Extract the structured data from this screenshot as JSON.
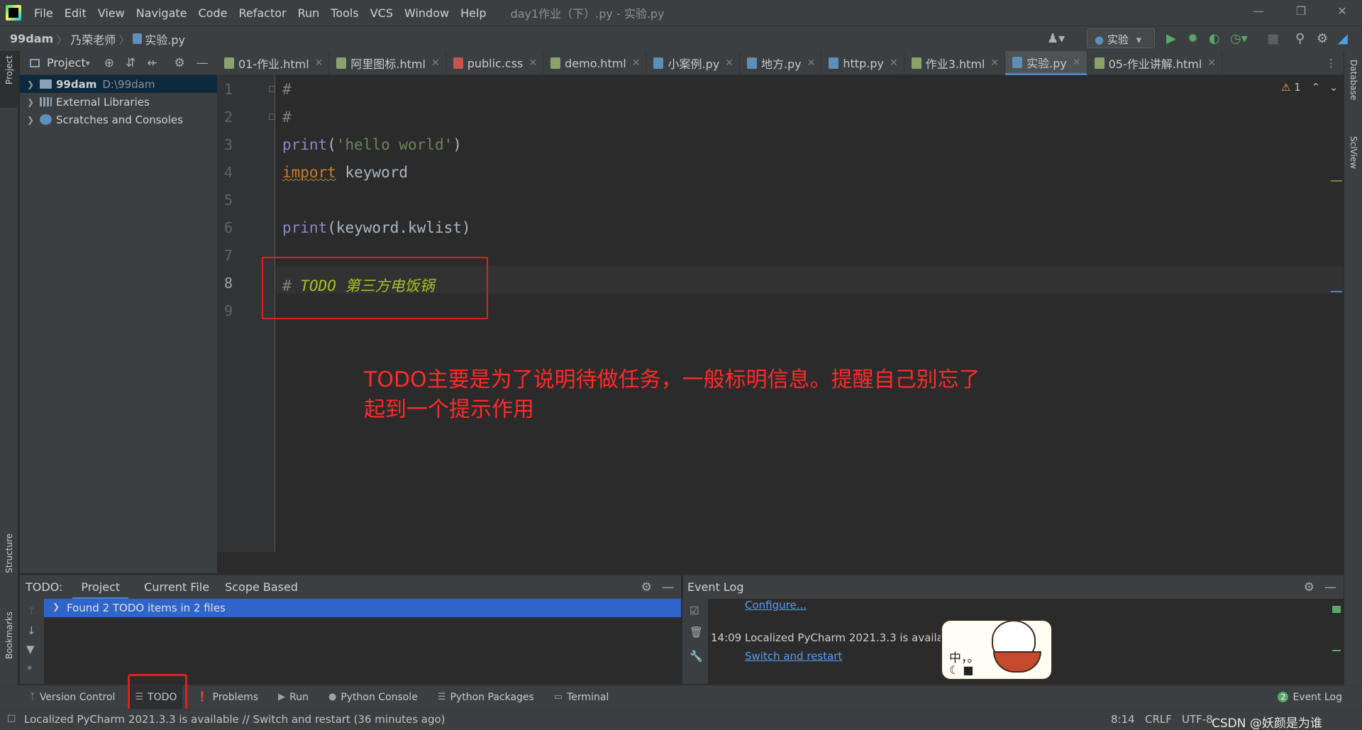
{
  "window": {
    "title": "day1作业（下）.py - 实验.py",
    "menu": [
      "File",
      "Edit",
      "View",
      "Navigate",
      "Code",
      "Refactor",
      "Run",
      "Tools",
      "VCS",
      "Window",
      "Help"
    ]
  },
  "breadcrumb": {
    "project": "99dam",
    "folder": "乃荣老师",
    "file": "实验.py"
  },
  "run_config": "实验",
  "project_panel": {
    "header": "Project",
    "items": [
      {
        "name": "99dam",
        "path": "D:\\99dam"
      },
      {
        "name": "External Libraries"
      },
      {
        "name": "Scratches and Consoles"
      }
    ]
  },
  "left_strip": {
    "project": "Project",
    "structure": "Structure",
    "bookmarks": "Bookmarks"
  },
  "right_strip": {
    "database": "Database",
    "sciview": "SciView"
  },
  "tabs": [
    {
      "label": "01-作业.html",
      "icon": "html-file-icon",
      "color": "#8aa36b"
    },
    {
      "label": "阿里图标.html",
      "icon": "html-file-icon",
      "color": "#8aa36b"
    },
    {
      "label": "public.css",
      "icon": "css-file-icon",
      "color": "#c75450"
    },
    {
      "label": "demo.html",
      "icon": "html-file-icon",
      "color": "#8aa36b"
    },
    {
      "label": "小案例.py",
      "icon": "python-file-icon",
      "color": "#5d8fb8"
    },
    {
      "label": "地方.py",
      "icon": "python-file-icon",
      "color": "#5d8fb8"
    },
    {
      "label": "http.py",
      "icon": "python-file-icon",
      "color": "#5d8fb8"
    },
    {
      "label": "作业3.html",
      "icon": "html-file-icon",
      "color": "#8aa36b"
    },
    {
      "label": "实验.py",
      "icon": "python-file-icon",
      "color": "#5d8fb8",
      "active": true
    },
    {
      "label": "05-作业讲解.html",
      "icon": "html-file-icon",
      "color": "#8aa36b"
    }
  ],
  "editor": {
    "line_numbers": [
      "1",
      "2",
      "3",
      "4",
      "5",
      "6",
      "7",
      "8",
      "9"
    ],
    "lines": {
      "l1": "#",
      "l2": "#",
      "l3_fn": "print",
      "l3_open": "(",
      "l3_str": "'hello world'",
      "l3_close": ")",
      "l4_kw": "import",
      "l4_rest": " keyword",
      "l6_fn": "print",
      "l6_rest": "(keyword.kwlist)",
      "l8_hash": "# ",
      "l8_todo": "TODO 第三方电饭锅"
    },
    "warnings": "1"
  },
  "annotation": {
    "line1": "TODO主要是为了说明待做任务，一般标明信息。提醒自己别忘了",
    "line2": "起到一个提示作用"
  },
  "todo_panel": {
    "label": "TODO:",
    "tabs": [
      "Project",
      "Current File",
      "Scope Based"
    ],
    "found": "Found 2 TODO items in 2 files"
  },
  "event_log": {
    "title": "Event Log",
    "configure_link": "Configure...",
    "time": "14:09",
    "message": "Localized PyCharm 2021.3.3 is available",
    "action_link": "Switch and restart"
  },
  "tool_windows": {
    "version_control": "Version Control",
    "todo": "TODO",
    "problems": "Problems",
    "run": "Run",
    "python_console": "Python Console",
    "python_packages": "Python Packages",
    "terminal": "Terminal",
    "event_log": "Event Log",
    "event_log_count": "2"
  },
  "status_bar": {
    "message": "Localized PyCharm 2021.3.3 is available // Switch and restart (36 minutes ago)",
    "position": "8:14",
    "line_sep": "CRLF",
    "encoding": "UTF-8",
    "watermark": "CSDN @妖颜是为谁"
  },
  "sticker": {
    "text": "中，。"
  }
}
